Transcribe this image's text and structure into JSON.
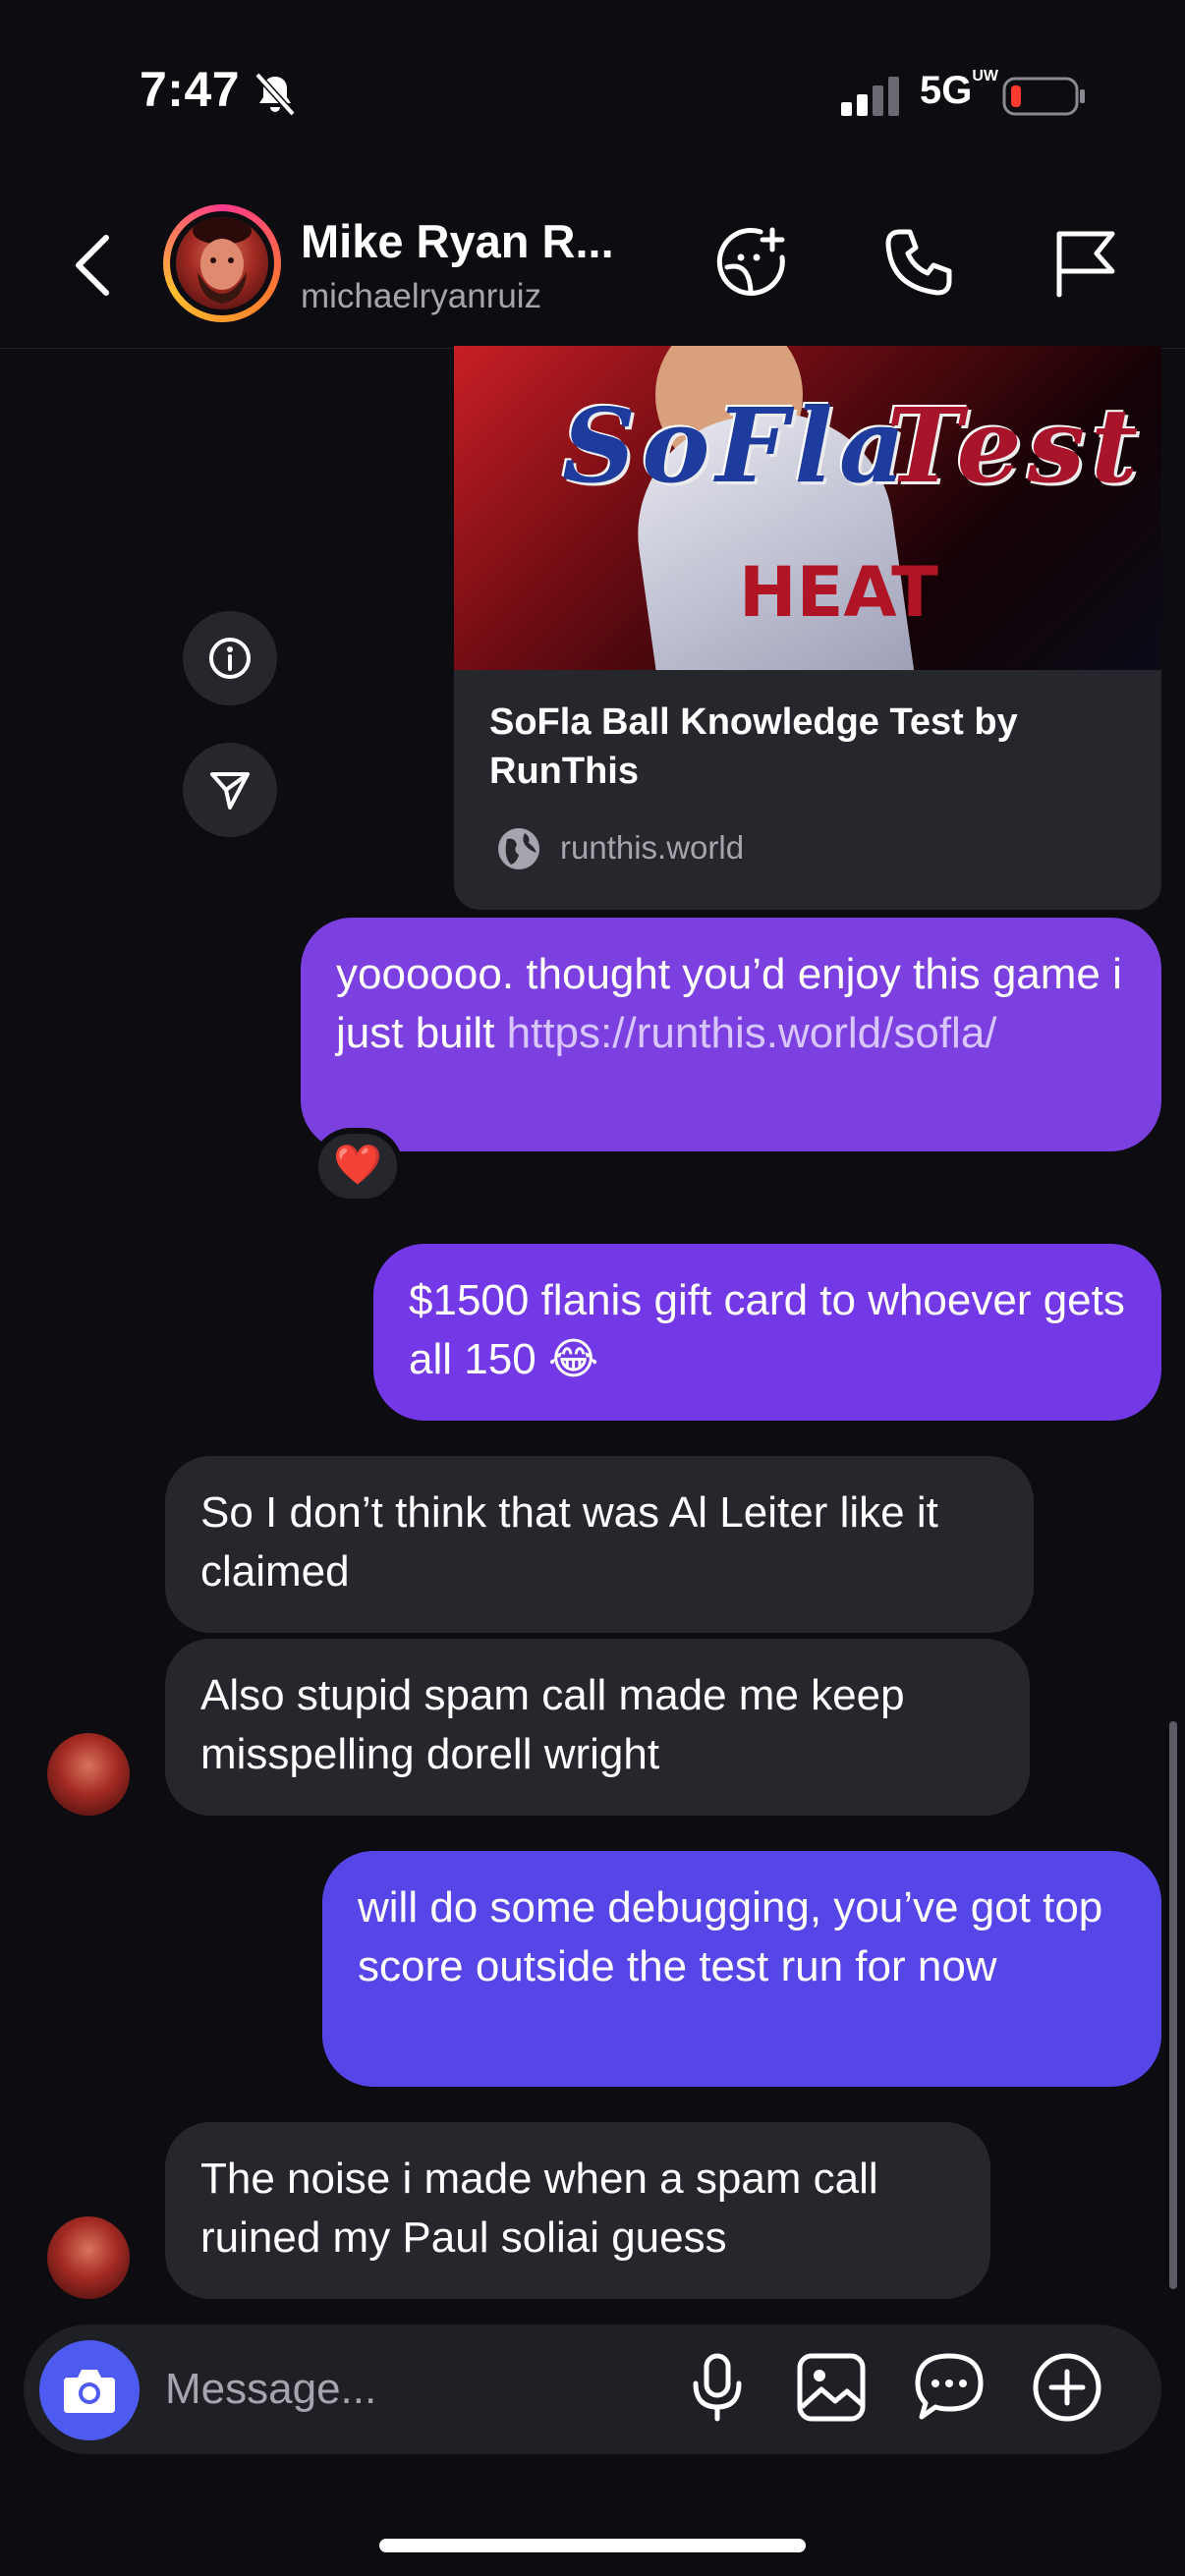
{
  "status": {
    "time": "7:47",
    "network": "5G",
    "network_suffix": "UW"
  },
  "header": {
    "name": "Mike Ryan R...",
    "username": "michaelryanruiz"
  },
  "link_card": {
    "image_text_left": "SoFla",
    "image_text_right": "Test",
    "title": "SoFla Ball Knowledge Test by RunThis",
    "domain": "runthis.world"
  },
  "messages": [
    {
      "direction": "outgoing",
      "text_before": "yoooooo. thought you’d enjoy this game i just built ",
      "link": "https://runthis.world/sofla/",
      "reaction": "❤️"
    },
    {
      "direction": "outgoing",
      "text": "$1500 flanis gift card to whoever gets all 150 😂"
    },
    {
      "direction": "incoming",
      "text": "So I don’t think that was Al Leiter like it claimed"
    },
    {
      "direction": "incoming",
      "text": "Also stupid spam call made me keep misspelling dorell wright"
    },
    {
      "direction": "outgoing",
      "text": "will do some debugging, you’ve got top score outside the test run for now"
    },
    {
      "direction": "incoming",
      "text": "The noise i made when a spam call ruined my Paul soliai guess"
    }
  ],
  "composer": {
    "placeholder": "Message..."
  },
  "icons": {
    "back": "chevron-left-icon",
    "sticker": "sticker-plus-icon",
    "call": "phone-icon",
    "report": "flag-icon",
    "info": "info-icon",
    "share": "send-icon",
    "camera": "camera-icon",
    "mic": "microphone-icon",
    "gallery": "image-icon",
    "chat": "chat-bubble-icon",
    "add": "plus-circle-icon"
  },
  "colors": {
    "background": "#0c0c11",
    "incoming_bubble": "#26272c",
    "outgoing_bubble_top": "#7c3fe0",
    "outgoing_bubble_bottom": "#5646e8",
    "camera_button": "#4d5bf0"
  }
}
